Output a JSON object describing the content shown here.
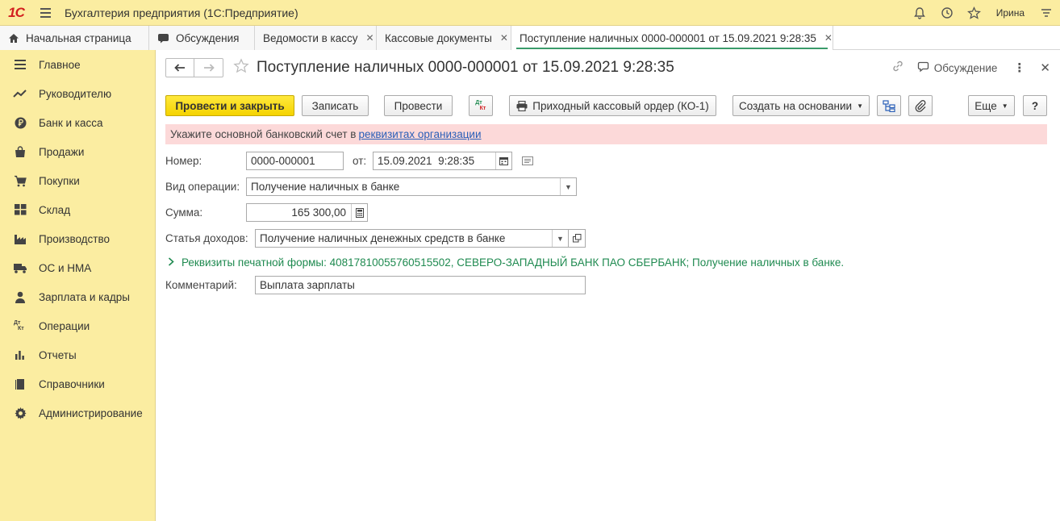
{
  "app": {
    "logo": "1С",
    "title": "Бухгалтерия предприятия (1С:Предприятие)",
    "user": "Ирина"
  },
  "tabs": [
    {
      "label": "Начальная страница",
      "icon": "home-icon"
    },
    {
      "label": "Обсуждения",
      "icon": "chat-icon"
    },
    {
      "label": "Ведомости в кассу",
      "closable": true
    },
    {
      "label": "Кассовые документы",
      "closable": true
    },
    {
      "label": "Поступление наличных 0000-000001 от 15.09.2021 9:28:35",
      "closable": true,
      "active": true
    }
  ],
  "sidebar": {
    "items": [
      {
        "label": "Главное",
        "icon": "menu-lines-icon"
      },
      {
        "label": "Руководителю",
        "icon": "trend-chart-icon"
      },
      {
        "label": "Банк и касса",
        "icon": "ruble-coin-icon"
      },
      {
        "label": "Продажи",
        "icon": "shopping-bag-icon"
      },
      {
        "label": "Покупки",
        "icon": "cart-icon"
      },
      {
        "label": "Склад",
        "icon": "grid-blocks-icon"
      },
      {
        "label": "Производство",
        "icon": "factory-icon"
      },
      {
        "label": "ОС и НМА",
        "icon": "truck-icon"
      },
      {
        "label": "Зарплата и кадры",
        "icon": "person-icon"
      },
      {
        "label": "Операции",
        "icon": "dt-kt-icon"
      },
      {
        "label": "Отчеты",
        "icon": "bar-chart-icon"
      },
      {
        "label": "Справочники",
        "icon": "book-icon"
      },
      {
        "label": "Администрирование",
        "icon": "gear-icon"
      }
    ]
  },
  "document": {
    "title": "Поступление наличных 0000-000001 от 15.09.2021 9:28:35",
    "discuss_label": "Обсуждение"
  },
  "toolbar": {
    "post_close": "Провести и закрыть",
    "save": "Записать",
    "post": "Провести",
    "dtkt_top": "Дт",
    "dtkt_bottom": "Кт",
    "print_order": "Приходный кассовый ордер (КО-1)",
    "create_based": "Создать на основании",
    "more": "Еще",
    "help": "?"
  },
  "alert": {
    "text": "Укажите основной банковский счет в",
    "link": "реквизитах организации"
  },
  "form": {
    "number_label": "Номер:",
    "number_value": "0000-000001",
    "date_label": "от:",
    "date_value": "15.09.2021  9:28:35",
    "operation_label": "Вид операции:",
    "operation_value": "Получение наличных в банке",
    "sum_label": "Сумма:",
    "sum_value": "165 300,00",
    "income_label": "Статья доходов:",
    "income_value": "Получение наличных денежных средств в банке",
    "print_details": "Реквизиты печатной формы: 40817810055760515502, СЕВЕРО-ЗАПАДНЫЙ БАНК ПАО СБЕРБАНК; Получение наличных в банке.",
    "comment_label": "Комментарий:",
    "comment_value": "Выплата зарплаты"
  }
}
